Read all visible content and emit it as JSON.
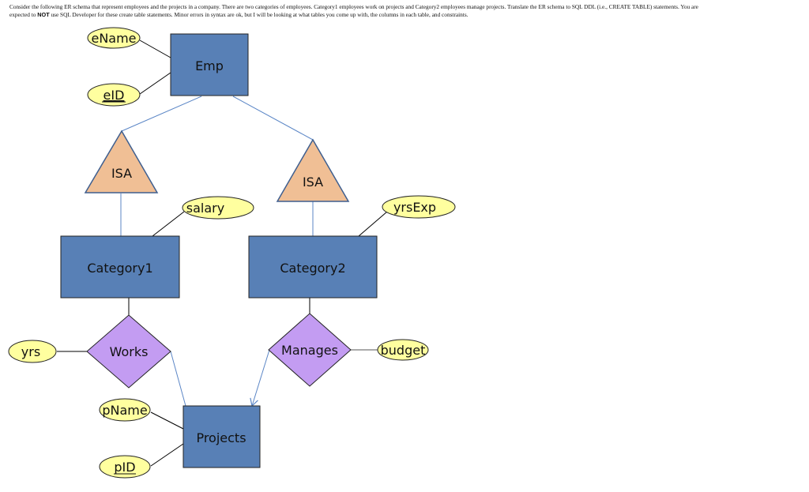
{
  "intro": {
    "line1": "Consider the following ER schema that represent employees and the projects in a company. There are two categories of employees. Category1 employees work on projects and Category2 employees manage projects. Translate the ER schema to SQL DDL (i.e., CREATE TABLE) statements. You are",
    "line2_pre": "expected to ",
    "line2_bold": "NOT",
    "line2_post": " use SQL Developer for these create table statements. Minor errors in syntax are ok, but I will be looking at what tables you come up with, the columns in each table, and constraints."
  },
  "diagram": {
    "colors": {
      "entity_fill": "#5880b6",
      "isa_fill": "#f0bf95",
      "relationship_fill": "#c39cf2",
      "attribute_fill": "#ffff9f",
      "isa_line": "#5b86c6",
      "line": "#000000"
    },
    "entities": {
      "emp": "Emp",
      "category1": "Category1",
      "category2": "Category2",
      "projects": "Projects"
    },
    "isa": {
      "left": "ISA",
      "right": "ISA"
    },
    "relationships": {
      "works": "Works",
      "manages": "Manages"
    },
    "attributes": {
      "ename": "eName",
      "eid": "eID",
      "salary": "salary",
      "yrsexp": "yrsExp",
      "yrs": "yrs",
      "budget": "budget",
      "pname": "pName",
      "pid": "pID"
    },
    "keys": [
      "eID",
      "pID"
    ]
  }
}
